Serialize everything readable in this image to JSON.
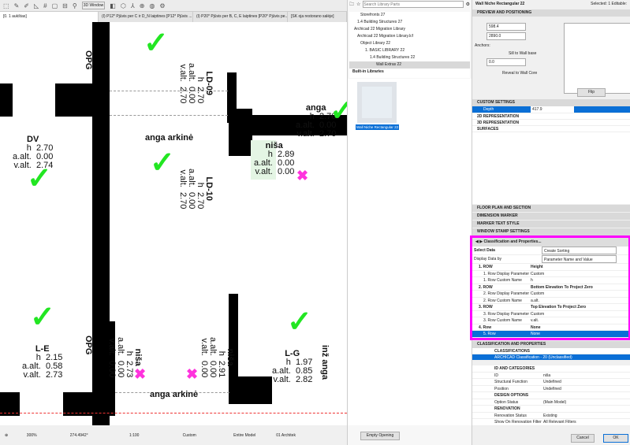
{
  "toolbar": {
    "window_3d": "3D Window"
  },
  "tabs": [
    "[0. 1 aukštas]",
    "(I) P12* Pjūvis per C ir D_N laiptines [P12* Pjūvis ...",
    "(I) P20* Pjūvis per B, C, E laiptines [P20* Pjūvis pe...",
    "[SK oja restorano salėje]"
  ],
  "drawing": {
    "dv": {
      "name": "DV",
      "h": "h  2.70",
      "a": "a.alt.  0.00",
      "v": "v.alt.  2.74"
    },
    "ld09": {
      "name": "LD-09",
      "h": "h  2.70",
      "a": "a.alt.  0.00",
      "v": "v.alt.  2.70"
    },
    "ld10": {
      "name": "LD-10",
      "h": "h  2.70",
      "a": "a.alt.  0.00",
      "v": "v.alt.  2.70"
    },
    "opg": "OPG",
    "opg2": "OPG",
    "anga_arkine": "anga arkinė",
    "anga_arkine2": "anga arkinė",
    "anga": {
      "name": "anga",
      "h": "h  2.70",
      "a": "a.alt.  0.00",
      "v": "v.alt.  2.70"
    },
    "nisa1": {
      "name": "niša",
      "h": "h  2.89",
      "a": "a.alt.  0.00",
      "v": "v.alt.  0.00"
    },
    "nisa2": {
      "name": "niša",
      "h": "h  2.73",
      "a": "a.alt.  0.00",
      "v": "v.alt.  0.00"
    },
    "nisa3": {
      "name": "niša",
      "h": "h  2.91",
      "a": "a.alt.  0.00",
      "v": "v.alt.  0.00"
    },
    "le": {
      "name": "L-E",
      "h": "h  2.15",
      "a": "a.alt.  0.58",
      "v": "v.alt.  2.73"
    },
    "lg": {
      "name": "L-G",
      "h": "h  1.97",
      "a": "a.alt.  0.85",
      "v": "v.alt.  2.82"
    },
    "inz": "inž anga"
  },
  "status": {
    "zoom": "300%",
    "angle": "274.4942°",
    "scale": "1:100",
    "pen": "Custom",
    "model": "Entire Model",
    "layer": "01 Architek"
  },
  "library": {
    "search_placeholder": "Search Library Parts",
    "tree": [
      "Storefronts 27",
      "1.4 Building Structures 27",
      "Archicad 22 Migration Library",
      "Archicad 22 Migration Library.lcf",
      "Object Library 22",
      "1. BASIC LIBRARY 22",
      "1.4 Building Structures 22",
      "Wall Extras 22",
      "Built-in Libraries"
    ],
    "preview_label": "Wall Niche Rectangular 22",
    "empty_opening": "Empty Opening"
  },
  "props": {
    "title": "Wall Niche Rectangular 22",
    "selected": "Selected: 1 Editable:",
    "preview_section": "PREVIEW AND POSITIONING",
    "width": "598.4",
    "height": "2890.0",
    "anchors": "Anchors:",
    "sill": "Sill to Wall base",
    "sill_val": "0.0",
    "reveal": "Reveal to Wall Core",
    "flip": "Flip",
    "custom_section": "CUSTOM SETTINGS",
    "depth_label": "Depth",
    "depth_val": "417.9",
    "subs": [
      "2D REPRESENTATION",
      "3D REPRESENTATION",
      "SURFACES"
    ],
    "sections": [
      "FLOOR PLAN AND SECTION",
      "DIMENSION MARKER",
      "MARKER TEXT STYLE",
      "WINDOW STAMP SETTINGS"
    ],
    "class_page": "Classification and Properties...",
    "select_data": "Select Data",
    "select_data_val": "Create Sorting",
    "display_by": "Display Data by",
    "display_by_val": "Parameter Name and Value",
    "rows": [
      [
        "1. ROW",
        "Height"
      ],
      [
        "1. Row Display Parameter Name as",
        "Custom"
      ],
      [
        "1. Row Custom Name",
        "h"
      ],
      [
        "2. ROW",
        "Bottom Elevation To Project Zero"
      ],
      [
        "2. Row Display Parameter Name as",
        "Custom"
      ],
      [
        "2. Row Custom Name",
        "a.alt."
      ],
      [
        "3. ROW",
        "Top Elevation To Project Zero"
      ],
      [
        "3. Row Display Parameter Name as",
        "Custom"
      ],
      [
        "3. Row Custom Name",
        "v.alt."
      ],
      [
        "4. Row",
        "None"
      ],
      [
        "5. Row",
        "None"
      ]
    ],
    "class_section": "CLASSIFICATION AND PROPERTIES",
    "classifications": "CLASSIFICATIONS",
    "class_item": "ARCHICAD Classification - 20 (Unclassified)",
    "prop_rows": [
      [
        "ID AND CATEGORIES",
        ""
      ],
      [
        "ID",
        "niša"
      ],
      [
        "Structural Function",
        "Undefined"
      ],
      [
        "Position",
        "Undefined"
      ],
      [
        "DESIGN OPTIONS",
        ""
      ],
      [
        "Option Status",
        "(Main Model)"
      ],
      [
        "RENOVATION",
        ""
      ],
      [
        "Renovation Status",
        "Existing"
      ],
      [
        "Show On Renovation Filter",
        "All Relevant Filters"
      ]
    ],
    "cancel": "Cancel",
    "ok": "OK"
  },
  "colors": {
    "highlight": "#ff00ff",
    "check": "#22e622",
    "selection": "#0a6fd6"
  }
}
